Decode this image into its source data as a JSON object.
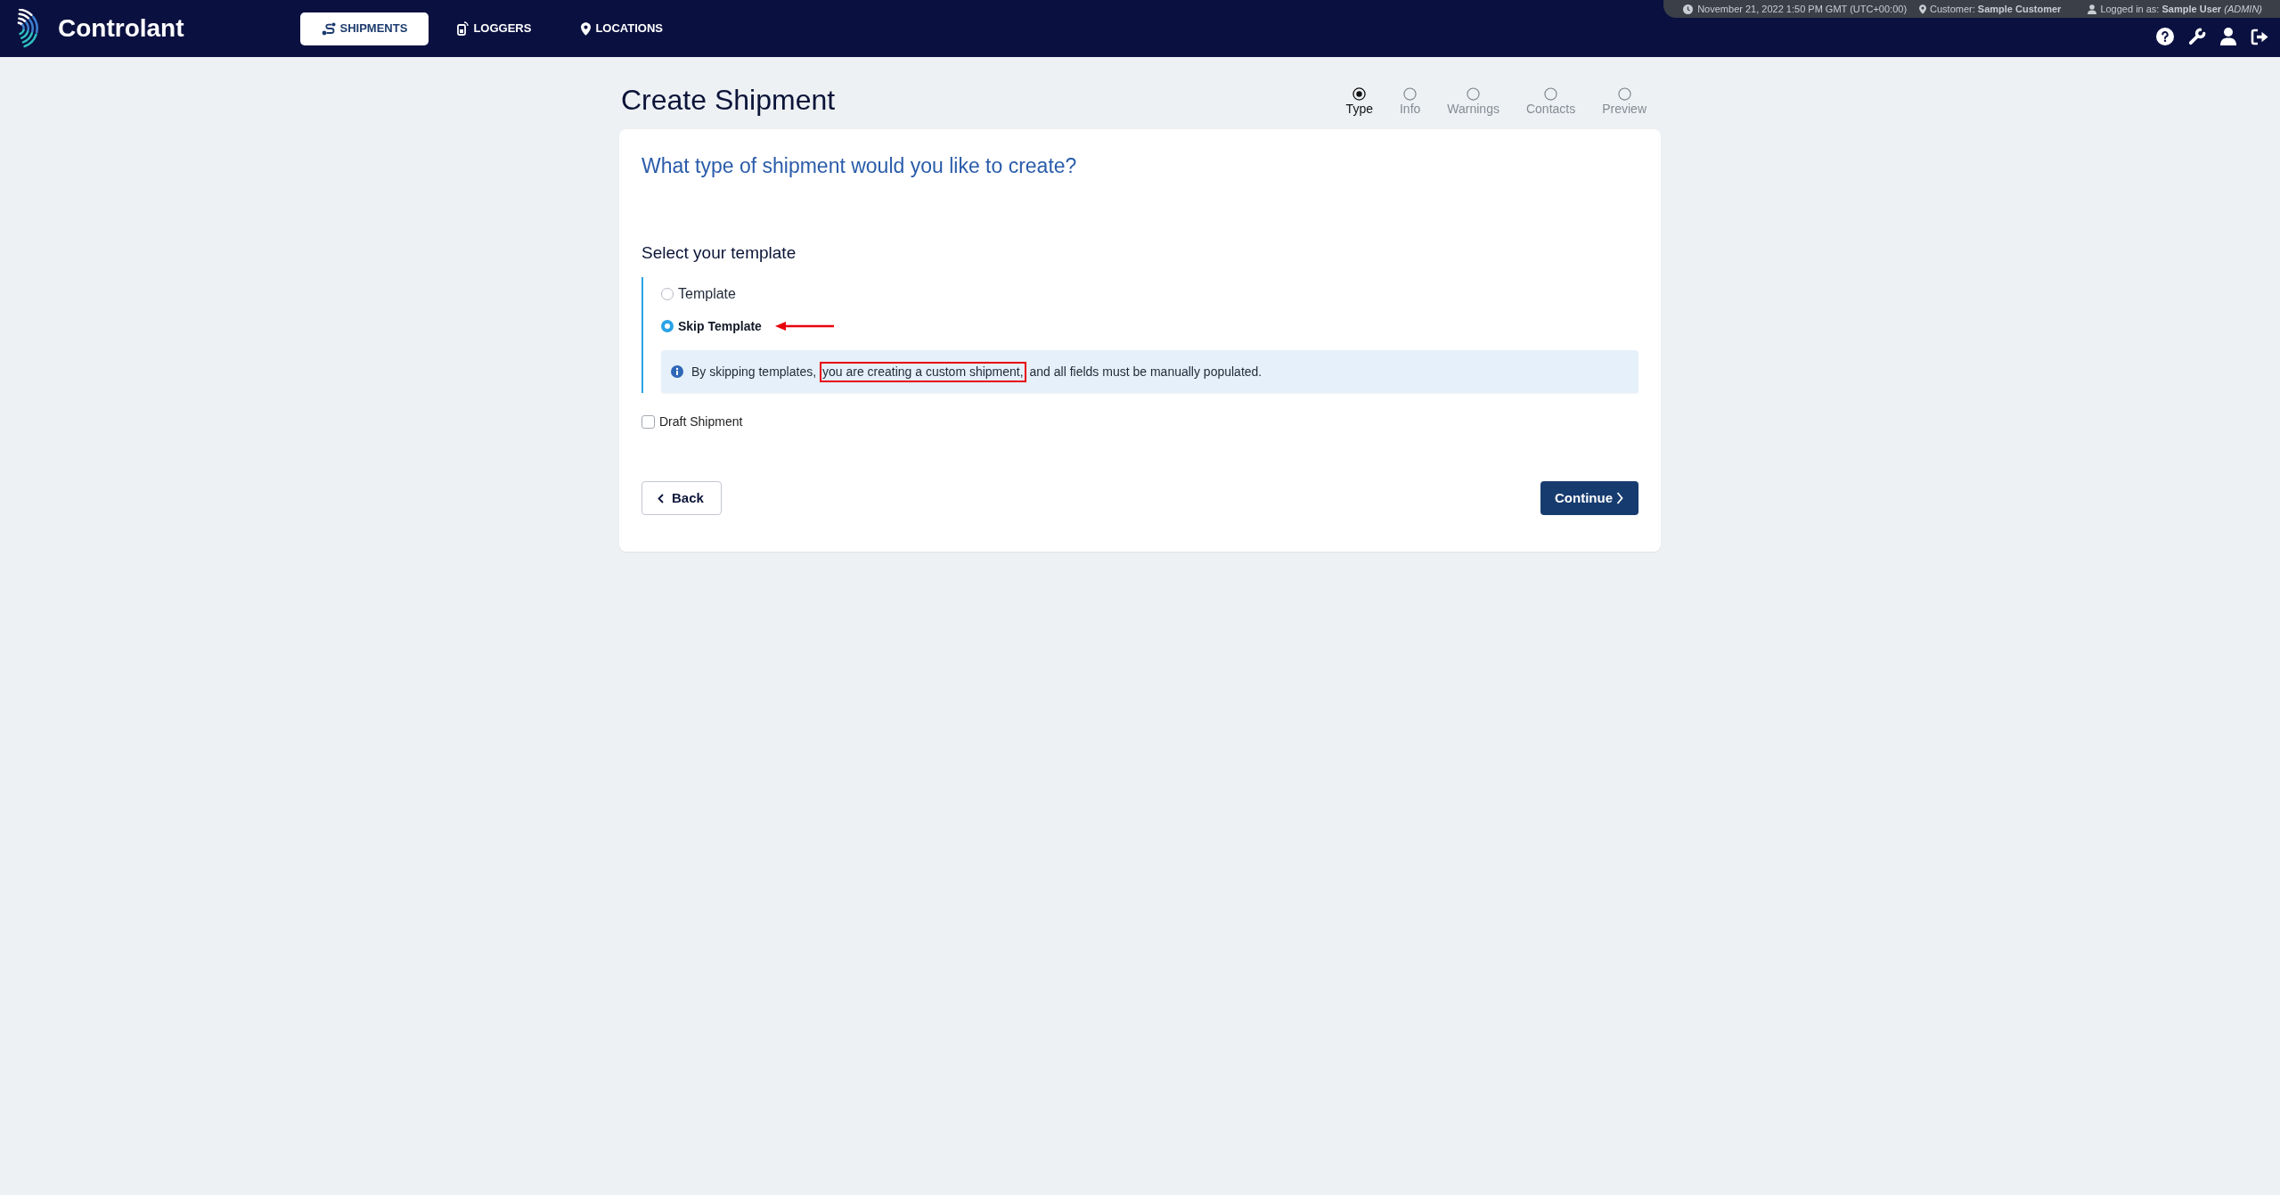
{
  "nav": {
    "brand": "Controlant",
    "tabs": [
      {
        "label": "SHIPMENTS",
        "selected": true
      },
      {
        "label": "LOGGERS",
        "selected": false
      },
      {
        "label": "LOCATIONS",
        "selected": false
      }
    ]
  },
  "status_bar": {
    "datetime": "November 21, 2022 1:50 PM GMT (UTC+00:00)",
    "customer": "Customer: **Sample Customer**",
    "user": "Logged in as: **Sample User** *(ADMIN)*"
  },
  "page": {
    "title": "Create Shipment",
    "steps": [
      {
        "label": "Type",
        "selected": true
      },
      {
        "label": "Info",
        "selected": false
      },
      {
        "label": "Warnings",
        "selected": false
      },
      {
        "label": "Contacts",
        "selected": false
      },
      {
        "label": "Preview",
        "selected": false
      }
    ]
  },
  "card": {
    "question": "What type of shipment would you like to create?",
    "section_title": "Select your template",
    "options": [
      {
        "label": "Template",
        "selected": false,
        "annotated": false
      },
      {
        "label": "Skip Template",
        "selected": true,
        "annotated": true
      }
    ],
    "info_note": {
      "segments": [
        {
          "text": "By skipping templates, ",
          "highlighted": false
        },
        {
          "text": "you are creating a custom shipment,",
          "highlighted": true
        },
        {
          "text": " and all fields must be manually populated.",
          "highlighted": false
        }
      ]
    },
    "draft": {
      "label": "Draft Shipment",
      "checked": false
    },
    "back_button": "Back",
    "continue_button": "Continue"
  }
}
